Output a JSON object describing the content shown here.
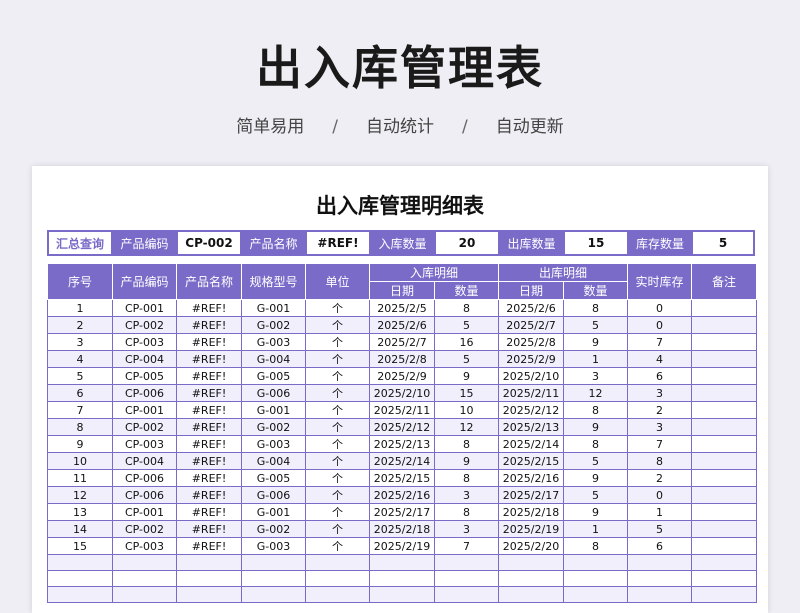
{
  "page": {
    "title": "出入库管理表",
    "tags": [
      "简单易用",
      "自动统计",
      "自动更新"
    ],
    "separator": "/"
  },
  "sheet": {
    "title": "出入库管理明细表",
    "summary": {
      "label": "汇总查询",
      "code_label": "产品编码",
      "code_value": "CP-002",
      "name_label": "产品名称",
      "name_value": "#REF!",
      "in_label": "入库数量",
      "in_value": "20",
      "out_label": "出库数量",
      "out_value": "15",
      "stock_label": "库存数量",
      "stock_value": "5"
    },
    "headers": {
      "seq": "序号",
      "code": "产品编码",
      "name": "产品名称",
      "spec": "规格型号",
      "unit": "单位",
      "in_group": "入库明细",
      "out_group": "出库明细",
      "date": "日期",
      "qty": "数量",
      "stock": "实时库存",
      "note": "备注"
    },
    "rows": [
      [
        "1",
        "CP-001",
        "#REF!",
        "G-001",
        "个",
        "2025/2/5",
        "8",
        "2025/2/6",
        "8",
        "0",
        ""
      ],
      [
        "2",
        "CP-002",
        "#REF!",
        "G-002",
        "个",
        "2025/2/6",
        "5",
        "2025/2/7",
        "5",
        "0",
        ""
      ],
      [
        "3",
        "CP-003",
        "#REF!",
        "G-003",
        "个",
        "2025/2/7",
        "16",
        "2025/2/8",
        "9",
        "7",
        ""
      ],
      [
        "4",
        "CP-004",
        "#REF!",
        "G-004",
        "个",
        "2025/2/8",
        "5",
        "2025/2/9",
        "1",
        "4",
        ""
      ],
      [
        "5",
        "CP-005",
        "#REF!",
        "G-005",
        "个",
        "2025/2/9",
        "9",
        "2025/2/10",
        "3",
        "6",
        ""
      ],
      [
        "6",
        "CP-006",
        "#REF!",
        "G-006",
        "个",
        "2025/2/10",
        "15",
        "2025/2/11",
        "12",
        "3",
        ""
      ],
      [
        "7",
        "CP-001",
        "#REF!",
        "G-001",
        "个",
        "2025/2/11",
        "10",
        "2025/2/12",
        "8",
        "2",
        ""
      ],
      [
        "8",
        "CP-002",
        "#REF!",
        "G-002",
        "个",
        "2025/2/12",
        "12",
        "2025/2/13",
        "9",
        "3",
        ""
      ],
      [
        "9",
        "CP-003",
        "#REF!",
        "G-003",
        "个",
        "2025/2/13",
        "8",
        "2025/2/14",
        "8",
        "7",
        ""
      ],
      [
        "10",
        "CP-004",
        "#REF!",
        "G-004",
        "个",
        "2025/2/14",
        "9",
        "2025/2/15",
        "5",
        "8",
        ""
      ],
      [
        "11",
        "CP-006",
        "#REF!",
        "G-005",
        "个",
        "2025/2/15",
        "8",
        "2025/2/16",
        "9",
        "2",
        ""
      ],
      [
        "12",
        "CP-006",
        "#REF!",
        "G-006",
        "个",
        "2025/2/16",
        "3",
        "2025/2/17",
        "5",
        "0",
        ""
      ],
      [
        "13",
        "CP-001",
        "#REF!",
        "G-001",
        "个",
        "2025/2/17",
        "8",
        "2025/2/18",
        "9",
        "1",
        ""
      ],
      [
        "14",
        "CP-002",
        "#REF!",
        "G-002",
        "个",
        "2025/2/18",
        "3",
        "2025/2/19",
        "1",
        "5",
        ""
      ],
      [
        "15",
        "CP-003",
        "#REF!",
        "G-003",
        "个",
        "2025/2/19",
        "7",
        "2025/2/20",
        "8",
        "6",
        ""
      ],
      [
        "",
        "",
        "",
        "",
        "",
        "",
        "",
        "",
        "",
        "",
        ""
      ],
      [
        "",
        "",
        "",
        "",
        "",
        "",
        "",
        "",
        "",
        "",
        ""
      ],
      [
        "",
        "",
        "",
        "",
        "",
        "",
        "",
        "",
        "",
        "",
        ""
      ]
    ]
  },
  "colors": {
    "accent": "#7b6bc9",
    "alt_row": "#f1effb",
    "background": "#eeeef4"
  }
}
